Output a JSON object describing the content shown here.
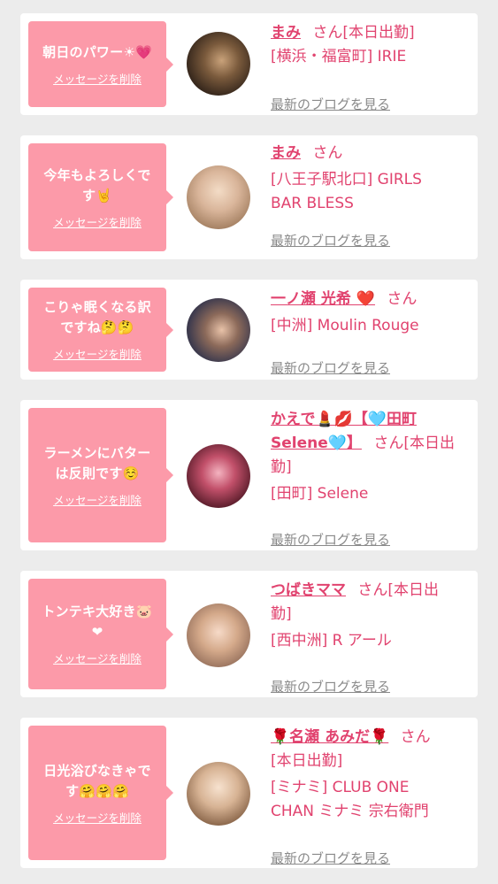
{
  "cards": [
    {
      "message": "朝日のパワー☀💗",
      "delete_label": "メッセージを削除",
      "name": "まみ",
      "suffix": "さん[本日出勤]",
      "shop": "[横浜・福富町] IRIE",
      "blog_label": "最新のブログを見る"
    },
    {
      "message": "今年もよろしくで\nす🤘",
      "delete_label": "メッセージを削除",
      "name": "まみ",
      "suffix": "さん",
      "shop": "[八王子駅北口] GIRLS\nBAR BLESS",
      "blog_label": "最新のブログを見る"
    },
    {
      "message": "こりゃ眠くなる訳\nですね🤔🤔",
      "delete_label": "メッセージを削除",
      "name": "一ノ瀬 光希 ❤️",
      "suffix": "さん",
      "shop": "[中洲] Moulin Rouge",
      "blog_label": "最新のブログを見る"
    },
    {
      "message": "ラーメンにバター\nは反則です☺️",
      "delete_label": "メッセージを削除",
      "name": "かえで💄💋【🩵田町\nSelene🩵】",
      "suffix": "さん[本日出\n勤]",
      "shop": "[田町] Selene",
      "blog_label": "最新のブログを見る"
    },
    {
      "message": "トンテキ大好き🐷\n❤",
      "delete_label": "メッセージを削除",
      "name": "つばきママ",
      "suffix": "さん[本日出\n勤]",
      "shop": "[西中洲] R アール",
      "blog_label": "最新のブログを見る"
    },
    {
      "message": "日光浴びなきゃで\nす🤗🤗🤗",
      "delete_label": "メッセージを削除",
      "name": "🌹名瀬 あみだ🌹",
      "suffix": "さん\n[本日出勤]",
      "shop": "[ミナミ] CLUB ONE\nCHAN ミナミ 宗右衛門",
      "blog_label": "最新のブログを見る"
    }
  ],
  "colors": {
    "bubble": "#fc9aa9",
    "accent": "#e1436f",
    "link_gray": "#8a8a8a",
    "background": "#ececec"
  }
}
